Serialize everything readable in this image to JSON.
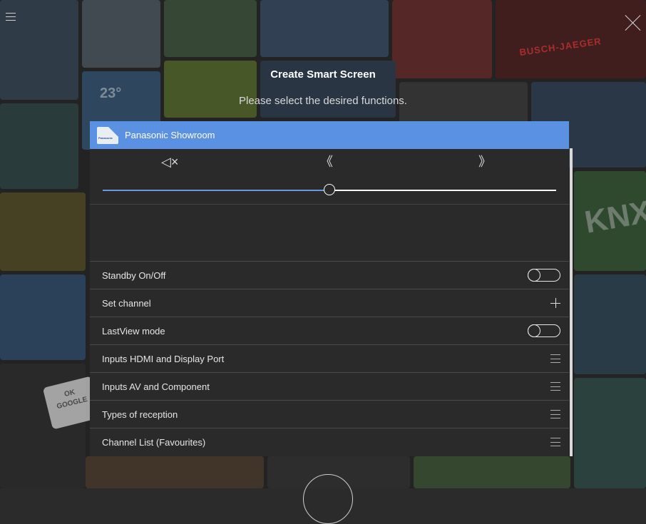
{
  "header": {
    "title": "Create Smart Screen",
    "subtitle": "Please select the desired functions."
  },
  "background": {
    "brand_tile_text": "BUSCH-JAEGER",
    "knx_text": "KNX",
    "temperature_text": "23°",
    "ok_google_line1": "OK",
    "ok_google_line2": "GOOGLE"
  },
  "panel": {
    "device_name": "Panasonic Showroom",
    "logo_text": "Panasonic",
    "controls": {
      "mute_glyph": "◁×",
      "prev_glyph": "《",
      "next_glyph": "》"
    },
    "volume_fraction": 0.5
  },
  "functions": [
    {
      "label": "Standby On/Off",
      "control": "toggle"
    },
    {
      "label": "Set channel",
      "control": "plus"
    },
    {
      "label": "LastView mode",
      "control": "toggle"
    },
    {
      "label": "Inputs HDMI and Display Port",
      "control": "menu"
    },
    {
      "label": "Inputs AV and Component",
      "control": "menu"
    },
    {
      "label": "Types of reception",
      "control": "menu"
    },
    {
      "label": "Channel List (Favourites)",
      "control": "menu"
    }
  ],
  "colors": {
    "header_blue": "#5a91e3",
    "slider_fill": "#6a97df",
    "panel_bg": "#2a2a2a"
  }
}
